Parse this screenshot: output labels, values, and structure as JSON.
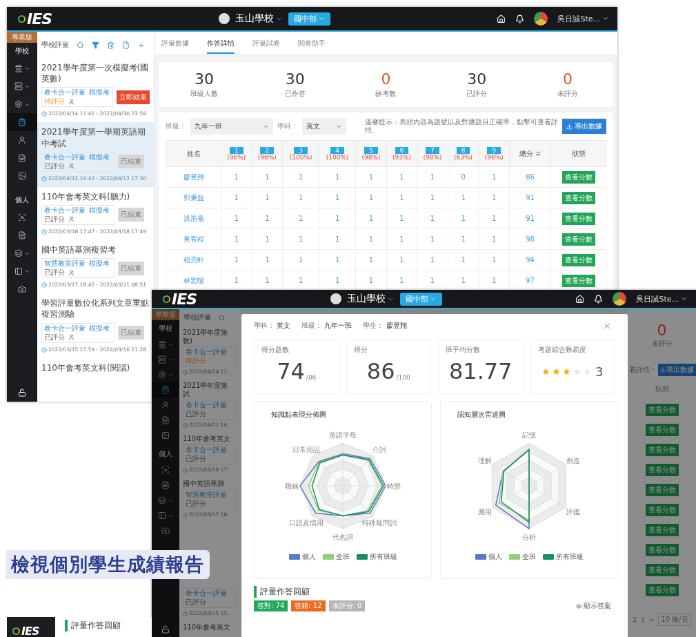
{
  "header": {
    "logo": "IES",
    "school": "玉山學校",
    "division": "國中部",
    "user": "吳日誠Ste..."
  },
  "sidebar": {
    "badge": "專業版",
    "school_label": "學校",
    "school_items": [
      {
        "selected": false
      },
      {
        "selected": false
      },
      {
        "selected": false
      },
      {
        "selected": true
      },
      {
        "selected": false
      },
      {
        "selected": false
      },
      {
        "selected": false
      }
    ],
    "personal_label": "個人",
    "personal_items": [
      {
        "selected": false
      },
      {
        "selected": false
      },
      {
        "selected": false
      },
      {
        "selected": false
      },
      {
        "selected": false
      }
    ]
  },
  "list_toolbar": {
    "title": "學校評量"
  },
  "assessments": [
    {
      "title": "2021學年度第一次模擬考(國英數)",
      "tags": [
        "卷卡合一評量",
        "模擬考"
      ],
      "status": {
        "label": "待評分",
        "kind": "pending"
      },
      "action": {
        "label": "立即結束",
        "kind": "end"
      },
      "period": "2022/04/14 11:41 - 2022/04/30 23:59",
      "selected": false
    },
    {
      "title": "2021學年度第一學期英語期中考試",
      "tags": [
        "卷卡合一評量",
        "模擬考"
      ],
      "status": {
        "label": "已評分",
        "kind": "graded"
      },
      "action": {
        "label": "已結束",
        "kind": "ended"
      },
      "period": "2022/04/12 16:42 - 2022/04/12 17:30",
      "selected": true
    },
    {
      "title": "110年會考英文科(聽力)",
      "tags": [
        "卷卡合一評量",
        "模擬考"
      ],
      "status": {
        "label": "已評分",
        "kind": "graded"
      },
      "action": {
        "label": "已結束",
        "kind": "ended"
      },
      "period": "2022/03/18 17:47 - 2022/03/18 17:49",
      "selected": false
    },
    {
      "title": "國中英語基測複習考",
      "tags": [
        "智慧教室評量",
        "模擬考"
      ],
      "status": {
        "label": "已評分",
        "kind": "graded"
      },
      "action": {
        "label": "已結束",
        "kind": "ended"
      },
      "period": "2022/03/17 18:42 - 2022/03/21 08:51",
      "selected": false
    },
    {
      "title": "學習評量數位化系列文章重點複習測驗",
      "tags": [
        "卷卡合一評量",
        "模擬考"
      ],
      "status": {
        "label": "已評分",
        "kind": "graded"
      },
      "action": {
        "label": "已結束",
        "kind": "ended"
      },
      "period": "2022/03/15 15:59 - 2022/03/16 21:28",
      "selected": false
    },
    {
      "title": "110年會考英文科(閱讀)",
      "selected": false
    }
  ],
  "tabs": [
    {
      "label": "評量數據",
      "selected": false
    },
    {
      "label": "作答詳情",
      "selected": true
    },
    {
      "label": "評量試卷",
      "selected": false
    },
    {
      "label": "閱卷助手",
      "selected": false
    }
  ],
  "stats": [
    {
      "value": "30",
      "label": "班級人數",
      "alert": false
    },
    {
      "value": "30",
      "label": "已作答",
      "alert": false
    },
    {
      "value": "0",
      "label": "缺考數",
      "alert": true
    },
    {
      "value": "30",
      "label": "已評分",
      "alert": false
    },
    {
      "value": "0",
      "label": "未評分",
      "alert": true
    }
  ],
  "filters": [
    {
      "label": "班級：",
      "value": "九年一班"
    },
    {
      "label": "學科：",
      "value": "英文"
    }
  ],
  "hint": "溫馨提示：表頭內容為題號以及對應題目正確率，點擊可查看詳情。",
  "export_button": "導出數據",
  "table": {
    "name_column": "姓名",
    "questions": [
      {
        "number": "1",
        "rate": "(96%)"
      },
      {
        "number": "2",
        "rate": "(96%)"
      },
      {
        "number": "3",
        "rate": "(100%)"
      },
      {
        "number": "4",
        "rate": "(100%)"
      },
      {
        "number": "5",
        "rate": "(98%)"
      },
      {
        "number": "6",
        "rate": "(93%)"
      },
      {
        "number": "7",
        "rate": "(98%)"
      },
      {
        "number": "8",
        "rate": "(63%)"
      },
      {
        "number": "9",
        "rate": "(96%)"
      }
    ],
    "total_column": "總分",
    "sort_mark": "≑",
    "status_column": "狀態",
    "rows": [
      {
        "name": "廖昱翔",
        "answers": [
          "1",
          "1",
          "1",
          "1",
          "1",
          "1",
          "1",
          "0",
          "1"
        ],
        "total": "86",
        "action": "查看分數"
      },
      {
        "name": "郭秉益",
        "answers": [
          "1",
          "1",
          "1",
          "1",
          "1",
          "1",
          "1",
          "1",
          "1"
        ],
        "total": "91",
        "action": "查看分數"
      },
      {
        "name": "洪浩嘉",
        "answers": [
          "1",
          "1",
          "1",
          "1",
          "1",
          "1",
          "1",
          "1",
          "1"
        ],
        "total": "91",
        "action": "查看分數"
      },
      {
        "name": "黃宥程",
        "answers": [
          "1",
          "1",
          "1",
          "1",
          "1",
          "1",
          "1",
          "1",
          "1"
        ],
        "total": "98",
        "action": "查看分數"
      },
      {
        "name": "程亮軒",
        "answers": [
          "1",
          "1",
          "1",
          "1",
          "1",
          "1",
          "1",
          "1",
          "1"
        ],
        "total": "94",
        "action": "查看分數"
      },
      {
        "name": "林宏暄",
        "answers": [
          "1",
          "1",
          "1",
          "1",
          "1",
          "1",
          "1",
          "1",
          "1"
        ],
        "total": "97",
        "action": "查看分數"
      }
    ]
  },
  "report_window": {
    "header": {
      "logo": "IES",
      "school": "玉山學校",
      "division": "國中部",
      "user": "吳日誠Ste..."
    },
    "sidebar": {
      "badge": "專業版",
      "school_label": "學校",
      "school_items": [
        {
          "selected": false
        },
        {
          "selected": false
        },
        {
          "selected": false
        },
        {
          "selected": true
        },
        {
          "selected": false
        },
        {
          "selected": false
        },
        {
          "selected": false
        }
      ],
      "personal_label": "個人",
      "personal_items": [
        {
          "selected": false
        },
        {
          "selected": false
        },
        {
          "selected": false
        },
        {
          "selected": false
        },
        {
          "selected": false
        }
      ]
    },
    "list_toolbar": "學校評量",
    "list_items": [
      {
        "title_lines": [
          "2021學年度第",
          "數)"
        ],
        "tag": "卷卡合一評量",
        "status": "待評分",
        "period": "2022/04/14 11:"
      },
      {
        "title_lines": [
          "2021學年度第",
          "試"
        ],
        "tag": "卷卡合一評量",
        "status": "已評分",
        "period": "2022/04/12 16:"
      },
      {
        "title_lines": [
          "110年會考英文"
        ],
        "tag": "卷卡合一評量",
        "status": "已評分",
        "period": "2022/03/18 17:"
      },
      {
        "title_lines": [
          "國中英語基測"
        ],
        "tag": "智慧教室評量",
        "status": "已評分",
        "period": "2022/03/17 18:"
      },
      {
        "tag": "卷卡合一評量",
        "status": "已評分",
        "period": "2022/03/15 15:"
      },
      {
        "title_lines": [
          "110年會考英文"
        ]
      }
    ],
    "right_strip": {
      "value": "0",
      "label": "未評分",
      "hint": "看詳情・",
      "export_button": "導出數據",
      "status_column": "狀態",
      "actions": [
        "查看分數",
        "查看分數",
        "查看分數",
        "查看分數",
        "查看分數",
        "查看分數",
        "查看分數",
        "查看分數",
        "查看分數",
        "查看分數"
      ],
      "pages": [
        "2",
        "3"
      ],
      "next": ">",
      "page_size": "10 條/頁"
    },
    "modal": {
      "meta": [
        {
          "label": "學科：",
          "value": "英文"
        },
        {
          "label": "班級：",
          "value": "九年一班"
        },
        {
          "label": "學生：",
          "value": "廖昱翔"
        }
      ],
      "close": "×",
      "cards": [
        {
          "kind": "score",
          "label": "得分題數",
          "value": "74",
          "suffix": "/86"
        },
        {
          "kind": "score",
          "label": "得分",
          "value": "86",
          "suffix": "/100"
        },
        {
          "kind": "score",
          "label": "班平均分數",
          "value": "81.77"
        },
        {
          "kind": "stars",
          "label": "考題綜合難易度",
          "stars": 3,
          "value": "3"
        }
      ],
      "radars": [
        {
          "title": "知識點表現分佈圖",
          "axes": [
            "英語字母",
            "介詞",
            "時態",
            "特殊疑問詞",
            "代名詞",
            "口語及慣用",
            "職稱",
            "日常用品"
          ],
          "legend": [
            {
              "label": "個人",
              "color": "#5b78c9"
            },
            {
              "label": "全班",
              "color": "#92cf7c"
            },
            {
              "label": "所有班級",
              "color": "#17905d"
            }
          ]
        },
        {
          "title": "認知層次雷達圖",
          "axes": [
            "記憶",
            "創造",
            "評鑑",
            "分析",
            "應用",
            "理解"
          ],
          "legend": [
            {
              "label": "個人",
              "color": "#5b78c9"
            },
            {
              "label": "全班",
              "color": "#92cf7c"
            },
            {
              "label": "所有班級",
              "color": "#17905d"
            }
          ]
        }
      ],
      "review": {
        "title": "評量作答回顧",
        "badges": [
          {
            "label": "答對: 74",
            "color": "#22a85a"
          },
          {
            "label": "答錯: 12",
            "color": "#f06a1d"
          },
          {
            "label": "未評分: 0",
            "color": "#b5b5b5"
          }
        ],
        "show_answer": "顯示答案"
      }
    }
  },
  "caption": "檢視個別學生成績報告",
  "third_window": {
    "logo": "IES",
    "section": "評量作答回顧"
  }
}
